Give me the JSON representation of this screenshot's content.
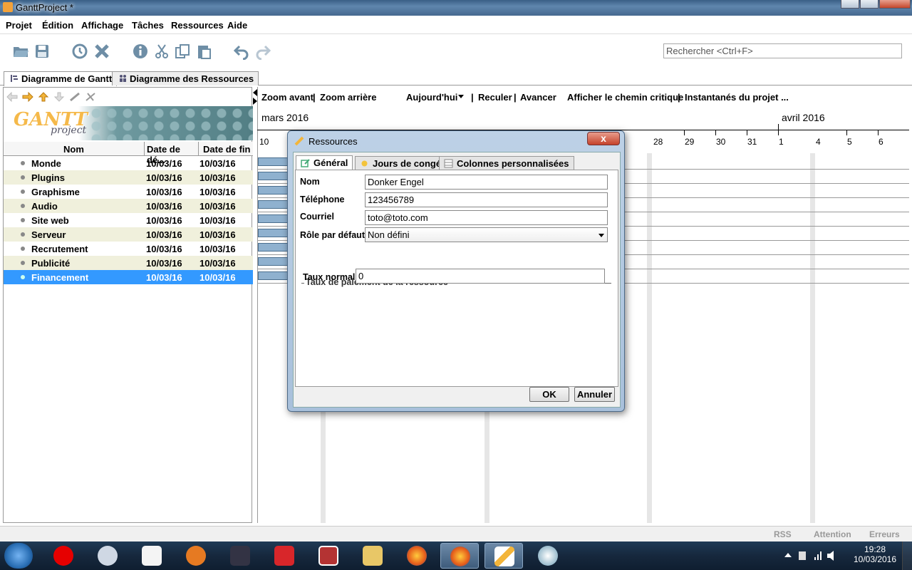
{
  "window": {
    "title": "GanttProject *"
  },
  "menu": [
    "Projet",
    "Édition",
    "Affichage",
    "Tâches",
    "Ressources",
    "Aide"
  ],
  "search": {
    "placeholder": "Rechercher <Ctrl+F>"
  },
  "tabs": [
    "Diagramme de Gantt",
    "Diagramme des Ressources"
  ],
  "logo": {
    "main": "GANTT",
    "sub": "project"
  },
  "table": {
    "headers": [
      "Nom",
      "Date de dé...",
      "Date de fin"
    ],
    "rows": [
      {
        "name": "Monde",
        "start": "10/03/16",
        "end": "10/03/16"
      },
      {
        "name": "Plugins",
        "start": "10/03/16",
        "end": "10/03/16"
      },
      {
        "name": "Graphisme",
        "start": "10/03/16",
        "end": "10/03/16"
      },
      {
        "name": "Audio",
        "start": "10/03/16",
        "end": "10/03/16"
      },
      {
        "name": "Site web",
        "start": "10/03/16",
        "end": "10/03/16"
      },
      {
        "name": "Serveur",
        "start": "10/03/16",
        "end": "10/03/16"
      },
      {
        "name": "Recrutement",
        "start": "10/03/16",
        "end": "10/03/16"
      },
      {
        "name": "Publicité",
        "start": "10/03/16",
        "end": "10/03/16"
      },
      {
        "name": "Financement",
        "start": "10/03/16",
        "end": "10/03/16"
      }
    ]
  },
  "chart_toolbar": {
    "zoom_in": "Zoom avant",
    "sep1": "|",
    "zoom_out": "Zoom arrière",
    "today": "Aujourd'hui",
    "sep2": "|",
    "back": "Reculer",
    "sep3": "|",
    "forward": "Avancer",
    "critical": "Afficher le chemin critique",
    "sep4": "|",
    "snapshots": "Instantanés du projet ..."
  },
  "timeline": {
    "months": [
      "mars 2016",
      "avril 2016"
    ],
    "days": [
      "10",
      "28",
      "29",
      "30",
      "31",
      "1",
      "4",
      "5",
      "6"
    ]
  },
  "dialog": {
    "title": "Ressources",
    "close": "x",
    "tabs": [
      "Général",
      "Jours de congés",
      "Colonnes personnalisées"
    ],
    "fields": {
      "name_label": "Nom",
      "name_value": "Donker Engel",
      "phone_label": "Téléphone",
      "phone_value": "123456789",
      "email_label": "Courriel",
      "email_value": "toto@toto.com",
      "role_label": "Rôle par défaut",
      "role_value": "Non défini"
    },
    "rate_group": "Taux de paiement de la ressource",
    "rate_label": "Taux normal",
    "rate_value": "0",
    "ok": "OK",
    "cancel": "Annuler"
  },
  "status": [
    "RSS",
    "Attention",
    "Erreurs"
  ],
  "clock": {
    "time": "19:28",
    "date": "10/03/2016"
  },
  "colors": {
    "selection": "#3399ff",
    "accent_bar": "#8fb1cf"
  }
}
